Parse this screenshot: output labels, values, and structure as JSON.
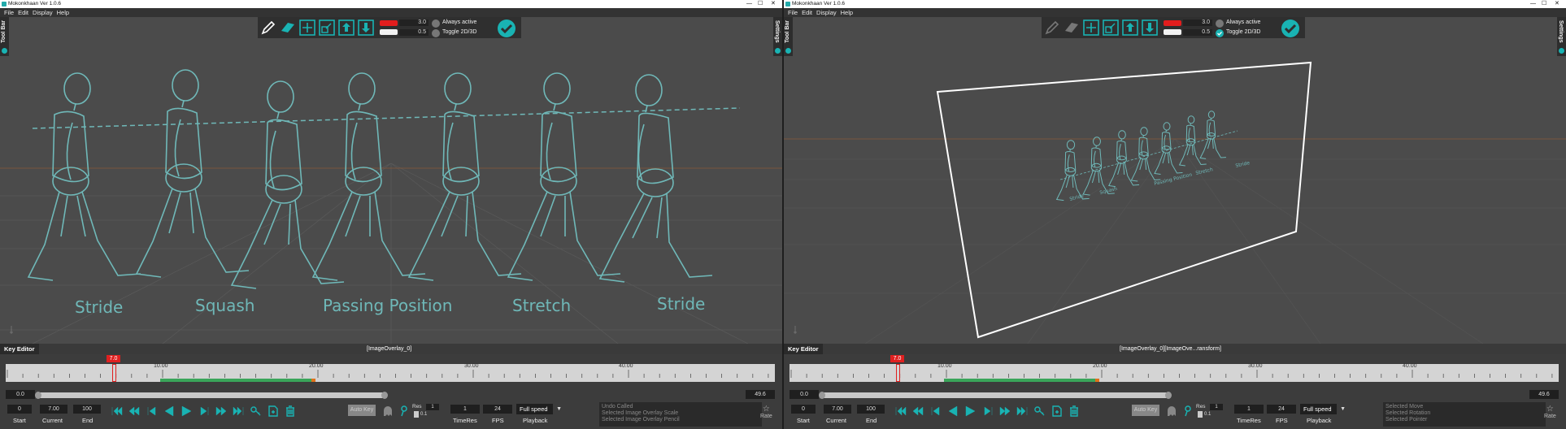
{
  "left": {
    "window_title": "Mokonkhaan Ver 1.0.6",
    "menu": [
      "File",
      "Edit",
      "Display",
      "Help"
    ],
    "side_left": "Tool Bar",
    "side_right": "Settings",
    "toolbar": {
      "value1": "3.0",
      "value2": "0.5",
      "always_active": "Always active",
      "toggle_2d3d": "Toggle 2D/3D"
    },
    "sketch_labels": [
      "Stride",
      "Squash",
      "Passing Position",
      "Stretch",
      "Stride"
    ],
    "key_editor": {
      "tab": "Key Editor",
      "object": "[ImageOverlay_0]",
      "playhead": "7.0",
      "ticks": [
        "10.00",
        "20.00",
        "30.00",
        "40.00"
      ],
      "range_start": "0.0",
      "range_end": "49.6",
      "start": "0",
      "current": "7.00",
      "end": "100",
      "start_label": "Start",
      "current_label": "Current",
      "end_label": "End",
      "auto_key": "Auto Key",
      "res_label": "Res",
      "res_value": "1",
      "res_small": "0.1",
      "timeres_value": "1",
      "timeres_label": "TimeRes",
      "fps_value": "24",
      "fps_label": "FPS",
      "playback_value": "Full speed",
      "playback_label": "Playback",
      "log": [
        "Undo Called",
        "Selected Image Overlay Scale",
        "Selected Image Overlay Pencil"
      ],
      "rate": "Rate"
    }
  },
  "right": {
    "window_title": "Mokonkhaan Ver 1.0.6",
    "menu": [
      "File",
      "Edit",
      "Display",
      "Help"
    ],
    "side_left": "Tool Bar",
    "side_right": "Settings",
    "toolbar": {
      "value1": "3.0",
      "value2": "0.5",
      "always_active": "Always active",
      "toggle_2d3d": "Toggle 2D/3D"
    },
    "sketch_labels": [
      "Stride",
      "Squash",
      "Passing Position",
      "Stretch",
      "Stride"
    ],
    "key_editor": {
      "tab": "Key Editor",
      "object": "[ImageOverlay_0][ImageOve...ransform]",
      "playhead": "7.0",
      "ticks": [
        "10.00",
        "20.00",
        "30.00",
        "40.00"
      ],
      "range_start": "0.0",
      "range_end": "49.6",
      "start": "0",
      "current": "7.00",
      "end": "100",
      "start_label": "Start",
      "current_label": "Current",
      "end_label": "End",
      "auto_key": "Auto Key",
      "res_label": "Res",
      "res_value": "1",
      "res_small": "0.1",
      "timeres_value": "1",
      "timeres_label": "TimeRes",
      "fps_value": "24",
      "fps_label": "FPS",
      "playback_value": "Full speed",
      "playback_label": "Playback",
      "log": [
        "Selected Move",
        "Selected Rotation",
        "Selected Pointer"
      ],
      "rate": "Rate"
    }
  },
  "colors": {
    "accent": "#19b3b3",
    "sketch": "#6fb8b8",
    "playhead": "#e02020",
    "range_active": "#3aa55a",
    "range_end": "#e0701a"
  },
  "icons": [
    "pencil-icon",
    "eraser-icon",
    "move-icon",
    "scale-icon",
    "import-icon",
    "export-icon",
    "check-icon",
    "skip-start-icon",
    "prev-key-icon",
    "step-back-icon",
    "play-reverse-icon",
    "play-icon",
    "step-forward-icon",
    "next-key-icon",
    "skip-end-icon",
    "key-icon",
    "add-key-icon",
    "delete-icon",
    "ghost-icon",
    "magnet-icon",
    "star-icon"
  ]
}
